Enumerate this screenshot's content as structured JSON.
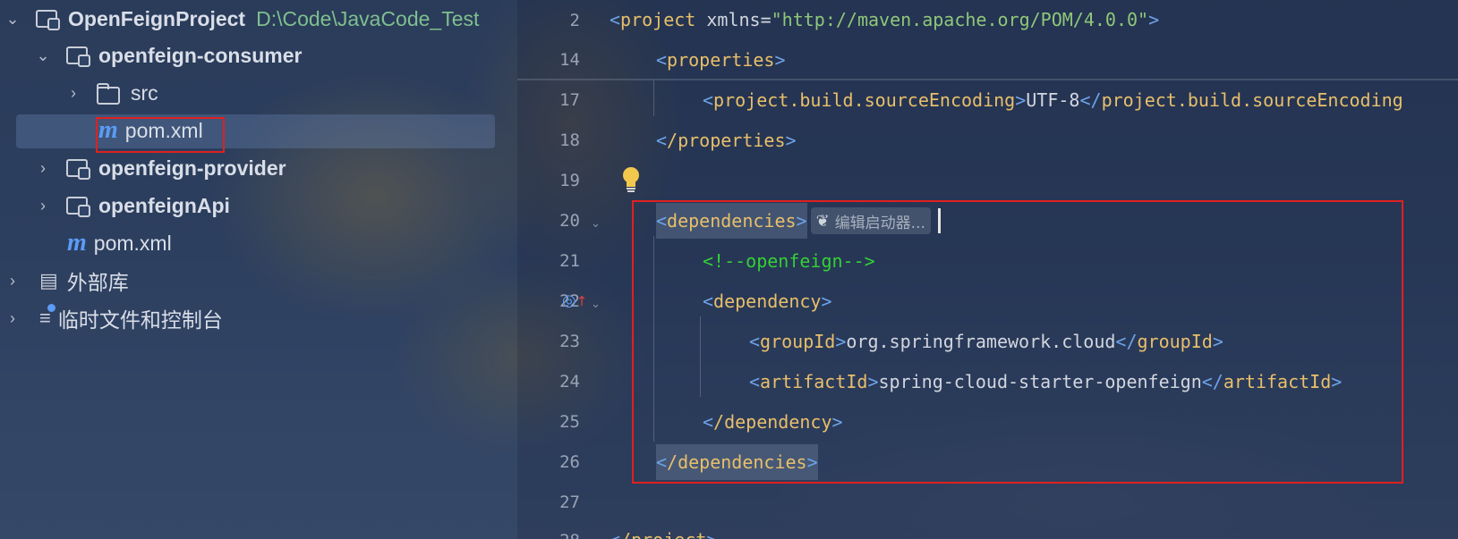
{
  "project_tree": {
    "root": {
      "name": "OpenFeignProject",
      "path": "D:\\Code\\JavaCode_Test"
    },
    "items": [
      {
        "label": "openfeign-consumer",
        "type": "module",
        "expanded": true
      },
      {
        "label": "src",
        "type": "folder",
        "expanded": false
      },
      {
        "label": "pom.xml",
        "type": "maven-file",
        "selected": true
      },
      {
        "label": "openfeign-provider",
        "type": "module",
        "expanded": false
      },
      {
        "label": "openfeignApi",
        "type": "module",
        "expanded": false
      },
      {
        "label": "pom.xml",
        "type": "maven-file"
      },
      {
        "label": "外部库",
        "type": "libraries"
      },
      {
        "label": "临时文件和控制台",
        "type": "scratches"
      }
    ]
  },
  "editor": {
    "line_numbers": [
      "2",
      "14",
      "17",
      "18",
      "19",
      "20",
      "21",
      "22",
      "23",
      "24",
      "25",
      "26",
      "27",
      "28"
    ],
    "lines": {
      "l2": {
        "tag": "project",
        "attr": "xmlns=",
        "value": "\"http://maven.apache.org/POM/4.0.0\""
      },
      "l14": {
        "tag": "properties"
      },
      "l17": {
        "tag_open": "project.build.sourceEncoding",
        "text": "UTF-8",
        "tag_close": "project.build.sourceEncoding"
      },
      "l18": {
        "tag": "/properties"
      },
      "l20": {
        "tag": "dependencies",
        "hint": "编辑启动器..."
      },
      "l21": {
        "comment": "<!--openfeign-->"
      },
      "l22": {
        "tag": "dependency"
      },
      "l23": {
        "tag_open": "groupId",
        "text": "org.springframework.cloud",
        "tag_close": "groupId"
      },
      "l24": {
        "tag_open": "artifactId",
        "text": "spring-cloud-starter-openfeign",
        "tag_close": "artifactId"
      },
      "l25": {
        "tag": "/dependency"
      },
      "l26": {
        "tag": "/dependencies"
      },
      "l28": {
        "tag": "/project"
      }
    }
  },
  "colors": {
    "tag": "#e8bf6a",
    "bracket": "#6ea3e8",
    "string": "#8fc77a",
    "comment": "#33d033",
    "highlight_box": "#e02020",
    "maven_icon": "#5b9cf6"
  }
}
